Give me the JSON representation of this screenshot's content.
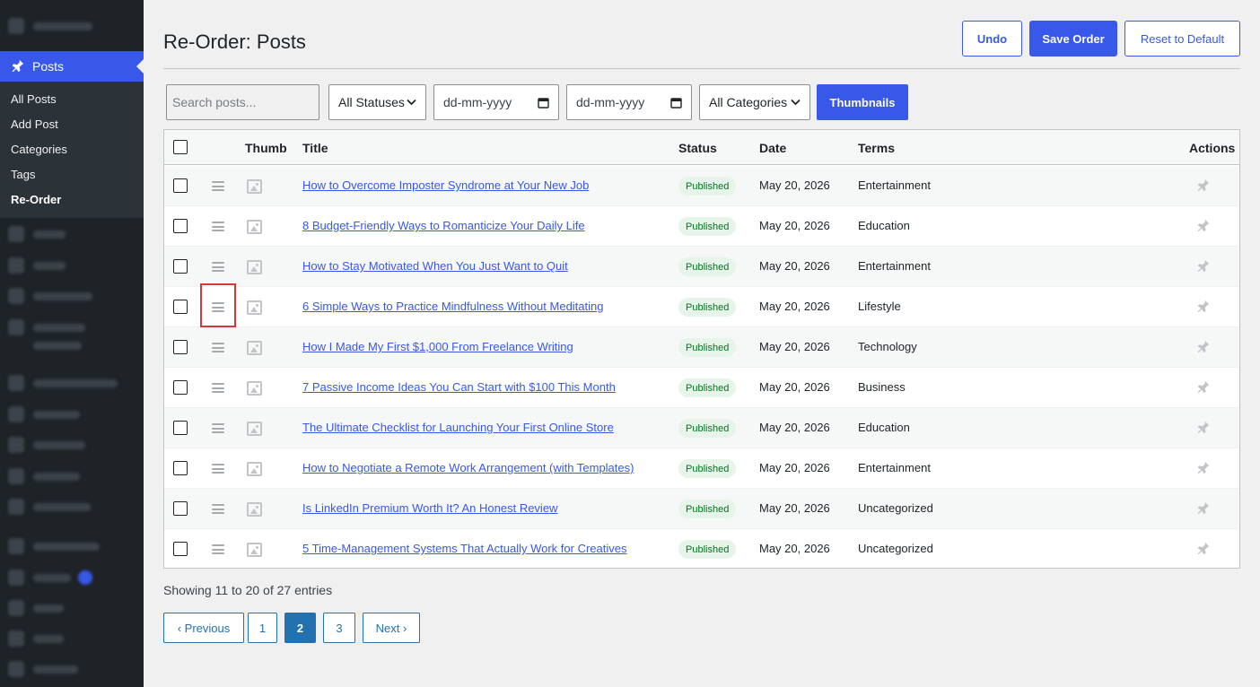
{
  "sidebar": {
    "active_label": "Posts",
    "submenu": [
      "All Posts",
      "Add Post",
      "Categories",
      "Tags",
      "Re-Order"
    ],
    "current_submenu": "Re-Order"
  },
  "header": {
    "title": "Re-Order: Posts",
    "undo": "Undo",
    "save": "Save Order",
    "reset": "Reset to Default"
  },
  "filters": {
    "search_placeholder": "Search posts...",
    "status": "All Statuses",
    "date_from": "dd-mm-yyyy",
    "date_to": "dd-mm-yyyy",
    "category": "All Categories",
    "thumbnails": "Thumbnails"
  },
  "table": {
    "columns": {
      "thumb": "Thumb",
      "title": "Title",
      "status": "Status",
      "date": "Date",
      "terms": "Terms",
      "actions": "Actions"
    },
    "rows": [
      {
        "title": "How to Overcome Imposter Syndrome at Your New Job",
        "status": "Published",
        "date": "May 20, 2026",
        "terms": "Entertainment"
      },
      {
        "title": "8 Budget-Friendly Ways to Romanticize Your Daily Life",
        "status": "Published",
        "date": "May 20, 2026",
        "terms": "Education"
      },
      {
        "title": "How to Stay Motivated When You Just Want to Quit",
        "status": "Published",
        "date": "May 20, 2026",
        "terms": "Entertainment"
      },
      {
        "title": "6 Simple Ways to Practice Mindfulness Without Meditating",
        "status": "Published",
        "date": "May 20, 2026",
        "terms": "Lifestyle"
      },
      {
        "title": "How I Made My First $1,000 From Freelance Writing",
        "status": "Published",
        "date": "May 20, 2026",
        "terms": "Technology"
      },
      {
        "title": "7 Passive Income Ideas You Can Start with $100 This Month",
        "status": "Published",
        "date": "May 20, 2026",
        "terms": "Business"
      },
      {
        "title": "The Ultimate Checklist for Launching Your First Online Store",
        "status": "Published",
        "date": "May 20, 2026",
        "terms": "Education"
      },
      {
        "title": "How to Negotiate a Remote Work Arrangement (with Templates)",
        "status": "Published",
        "date": "May 20, 2026",
        "terms": "Entertainment"
      },
      {
        "title": "Is LinkedIn Premium Worth It? An Honest Review",
        "status": "Published",
        "date": "May 20, 2026",
        "terms": "Uncategorized"
      },
      {
        "title": "5 Time-Management Systems That Actually Work for Creatives",
        "status": "Published",
        "date": "May 20, 2026",
        "terms": "Uncategorized"
      }
    ]
  },
  "footer": {
    "showing": "Showing 11 to 20 of 27 entries",
    "prev": "‹ Previous",
    "pages": [
      "1",
      "2",
      "3"
    ],
    "current_page": "2",
    "next": "Next ›"
  },
  "colors": {
    "accent": "#3858e9",
    "sidebar": "#1d2327",
    "badge_bg": "#e6f4ea",
    "badge_text": "#00761d",
    "highlight": "#d63638"
  },
  "icons": [
    "pin-icon",
    "drag-handle-icon",
    "image-placeholder-icon",
    "chevron-down-icon",
    "calendar-icon"
  ]
}
